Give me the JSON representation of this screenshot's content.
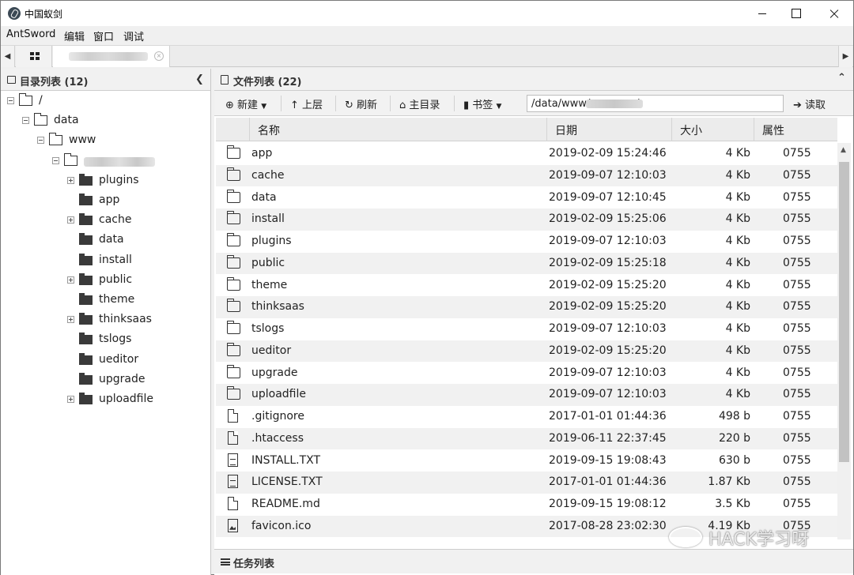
{
  "window": {
    "title": "中国蚁剑"
  },
  "menu": [
    "AntSword",
    "编辑",
    "窗口",
    "调试"
  ],
  "left_panel": {
    "title": "目录列表 (12)"
  },
  "tree": [
    {
      "label": "/",
      "depth": 0,
      "state": "open"
    },
    {
      "label": "data",
      "depth": 1,
      "state": "open"
    },
    {
      "label": "www",
      "depth": 2,
      "state": "open"
    },
    {
      "label": "",
      "depth": 3,
      "state": "open",
      "redacted": true
    },
    {
      "label": "plugins",
      "depth": 4,
      "state": "closed",
      "expandable": true
    },
    {
      "label": "app",
      "depth": 4,
      "state": "closed",
      "expandable": false
    },
    {
      "label": "cache",
      "depth": 4,
      "state": "closed",
      "expandable": true
    },
    {
      "label": "data",
      "depth": 4,
      "state": "closed",
      "expandable": false
    },
    {
      "label": "install",
      "depth": 4,
      "state": "closed",
      "expandable": false
    },
    {
      "label": "public",
      "depth": 4,
      "state": "closed",
      "expandable": true
    },
    {
      "label": "theme",
      "depth": 4,
      "state": "closed",
      "expandable": false
    },
    {
      "label": "thinksaas",
      "depth": 4,
      "state": "closed",
      "expandable": true
    },
    {
      "label": "tslogs",
      "depth": 4,
      "state": "closed",
      "expandable": false
    },
    {
      "label": "ueditor",
      "depth": 4,
      "state": "closed",
      "expandable": false
    },
    {
      "label": "upgrade",
      "depth": 4,
      "state": "closed",
      "expandable": false
    },
    {
      "label": "uploadfile",
      "depth": 4,
      "state": "closed",
      "expandable": true
    }
  ],
  "right_panel": {
    "title": "文件列表 (22)"
  },
  "toolbar": {
    "new_label": "新建",
    "up_label": "上层",
    "refresh_label": "刷新",
    "home_label": "主目录",
    "bookmark_label": "书签",
    "path_value": "/data/www/            n/",
    "read_label": "读取"
  },
  "columns": [
    "名称",
    "日期",
    "大小",
    "属性"
  ],
  "files": [
    {
      "icon": "folder",
      "name": "app",
      "date": "2019-02-09 15:24:46",
      "size": "4 Kb",
      "perm": "0755"
    },
    {
      "icon": "folder",
      "name": "cache",
      "date": "2019-09-07 12:10:03",
      "size": "4 Kb",
      "perm": "0755"
    },
    {
      "icon": "folder",
      "name": "data",
      "date": "2019-09-07 12:10:45",
      "size": "4 Kb",
      "perm": "0755"
    },
    {
      "icon": "folder",
      "name": "install",
      "date": "2019-02-09 15:25:06",
      "size": "4 Kb",
      "perm": "0755"
    },
    {
      "icon": "folder",
      "name": "plugins",
      "date": "2019-09-07 12:10:03",
      "size": "4 Kb",
      "perm": "0755"
    },
    {
      "icon": "folder",
      "name": "public",
      "date": "2019-02-09 15:25:18",
      "size": "4 Kb",
      "perm": "0755"
    },
    {
      "icon": "folder",
      "name": "theme",
      "date": "2019-02-09 15:25:20",
      "size": "4 Kb",
      "perm": "0755"
    },
    {
      "icon": "folder",
      "name": "thinksaas",
      "date": "2019-02-09 15:25:20",
      "size": "4 Kb",
      "perm": "0755"
    },
    {
      "icon": "folder",
      "name": "tslogs",
      "date": "2019-09-07 12:10:03",
      "size": "4 Kb",
      "perm": "0755"
    },
    {
      "icon": "folder",
      "name": "ueditor",
      "date": "2019-02-09 15:25:20",
      "size": "4 Kb",
      "perm": "0755"
    },
    {
      "icon": "folder",
      "name": "upgrade",
      "date": "2019-09-07 12:10:03",
      "size": "4 Kb",
      "perm": "0755"
    },
    {
      "icon": "folder",
      "name": "uploadfile",
      "date": "2019-09-07 12:10:03",
      "size": "4 Kb",
      "perm": "0755"
    },
    {
      "icon": "file",
      "name": ".gitignore",
      "date": "2017-01-01 01:44:36",
      "size": "498 b",
      "perm": "0755"
    },
    {
      "icon": "file",
      "name": ".htaccess",
      "date": "2019-06-11 22:37:45",
      "size": "220 b",
      "perm": "0755"
    },
    {
      "icon": "text",
      "name": "INSTALL.TXT",
      "date": "2019-09-15 19:08:43",
      "size": "630 b",
      "perm": "0755"
    },
    {
      "icon": "text",
      "name": "LICENSE.TXT",
      "date": "2017-01-01 01:44:36",
      "size": "1.87 Kb",
      "perm": "0755"
    },
    {
      "icon": "file",
      "name": "README.md",
      "date": "2019-09-15 19:08:12",
      "size": "3.5 Kb",
      "perm": "0755"
    },
    {
      "icon": "image",
      "name": "favicon.ico",
      "date": "2017-08-28 23:02:30",
      "size": "4.19 Kb",
      "perm": "0755"
    }
  ],
  "task_panel": {
    "title": "任务列表"
  },
  "watermark": "HACK学习呀"
}
